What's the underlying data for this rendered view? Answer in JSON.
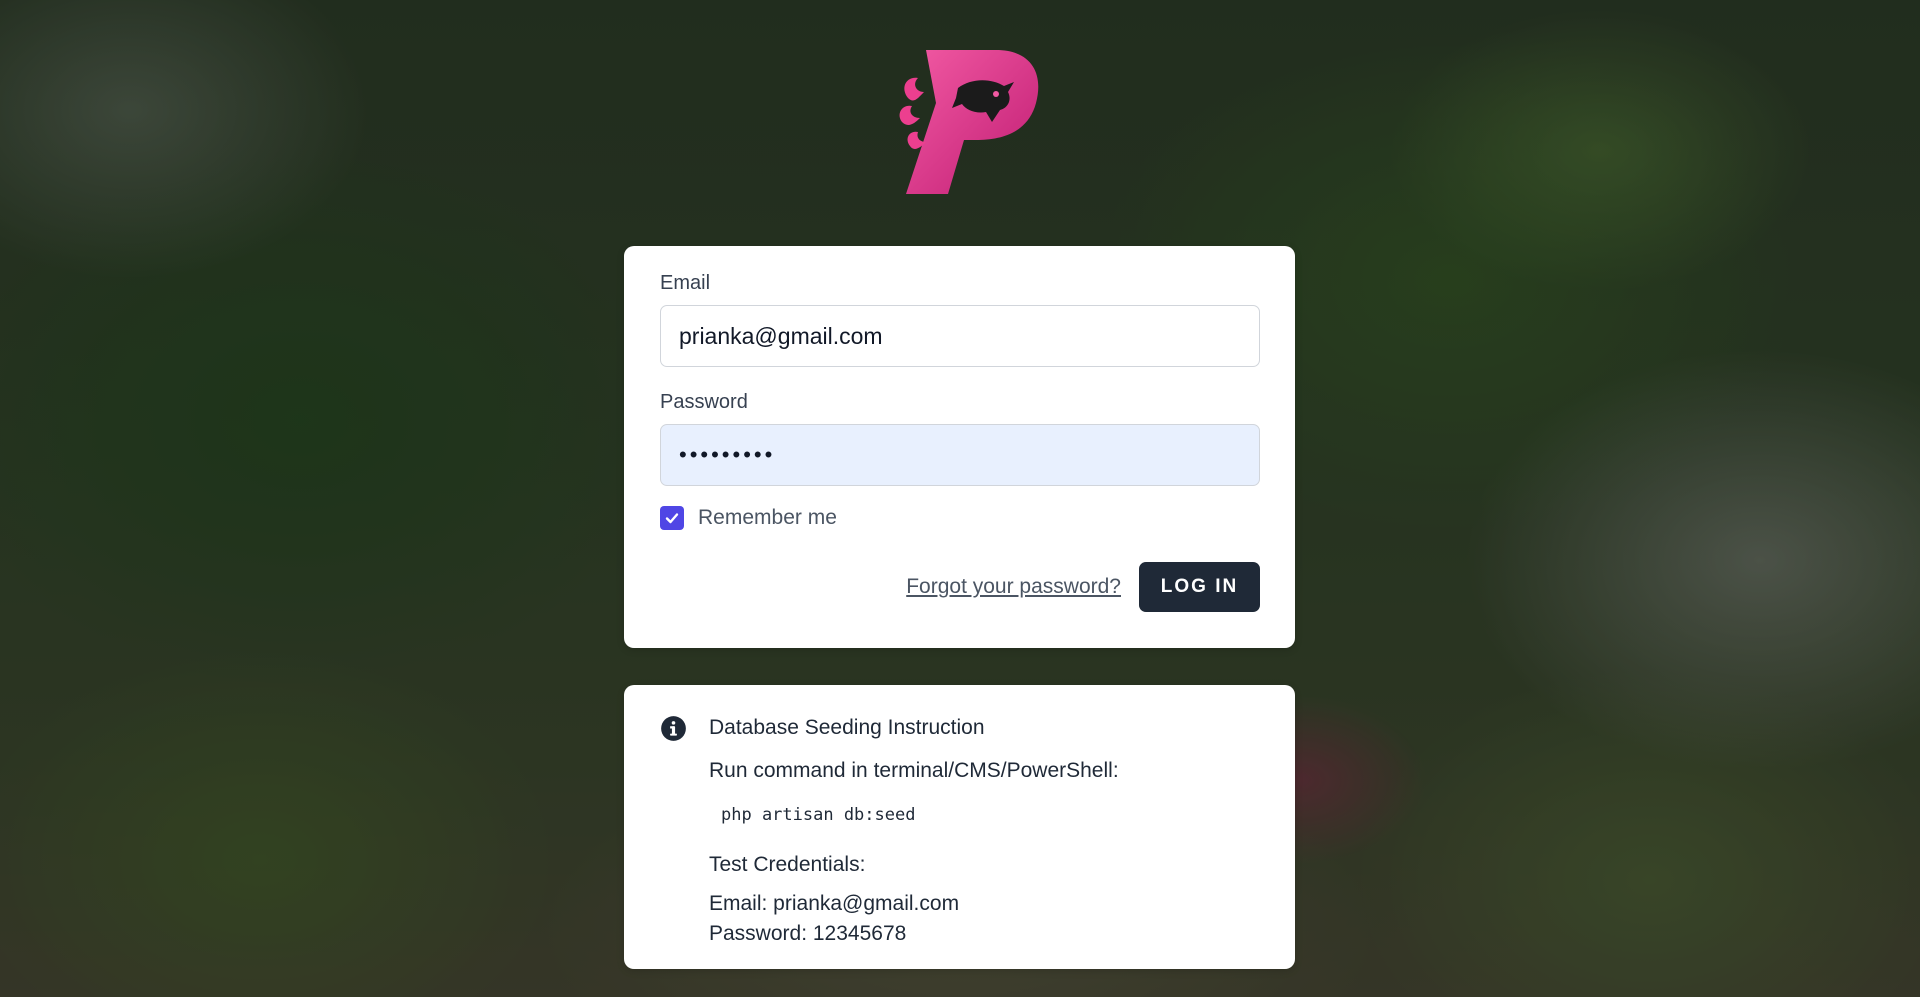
{
  "logo": {
    "name": "dragon-p-logo",
    "colors": {
      "primary": "#ec3f8f",
      "dark": "#b0176a"
    }
  },
  "login": {
    "email_label": "Email",
    "email_value": "prianka@gmail.com",
    "password_label": "Password",
    "password_value": "•••••••••",
    "remember_label": "Remember me",
    "remember_checked": true,
    "forgot_link": "Forgot your password?",
    "login_button": "LOG IN"
  },
  "info": {
    "icon": "info-circle-icon",
    "title": "Database Seeding Instruction",
    "instruction": "Run command in terminal/CMS/PowerShell:",
    "command": "php artisan db:seed",
    "creds_title": "Test Credentials:",
    "email_line": "Email: prianka@gmail.com",
    "password_line": "Password: 12345678"
  },
  "colors": {
    "button_bg": "#1f2937",
    "checkbox": "#4f46e5",
    "autofill_bg": "#e8f0fe"
  }
}
